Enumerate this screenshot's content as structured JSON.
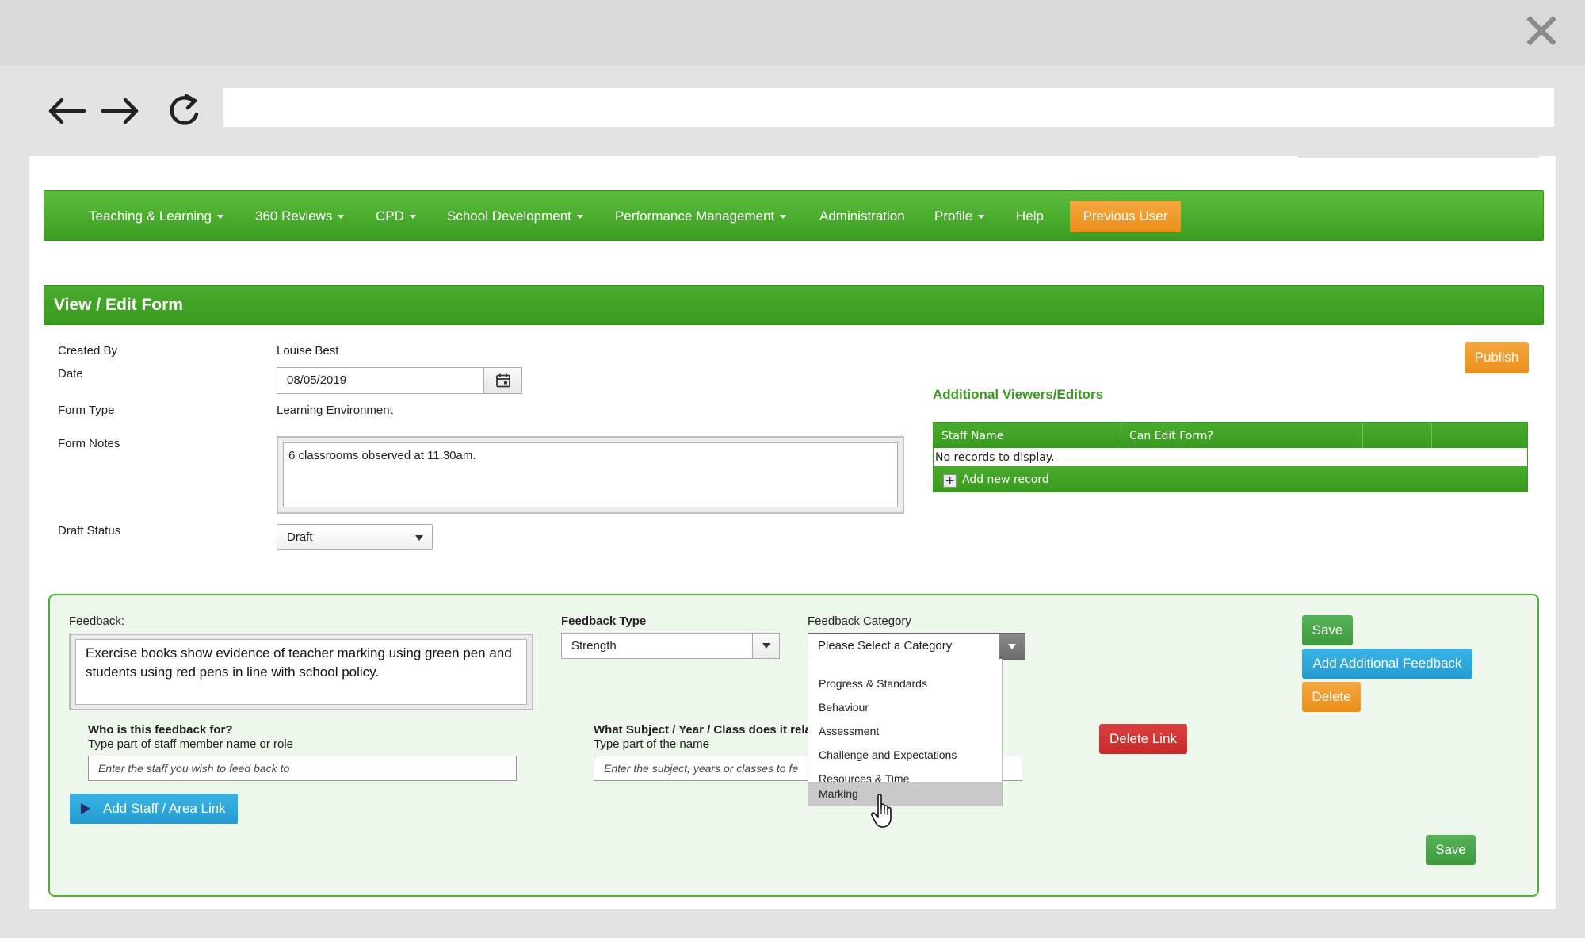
{
  "browser": {
    "address_value": ""
  },
  "nav": {
    "items": [
      {
        "label": "Teaching & Learning",
        "dropdown": true
      },
      {
        "label": "360 Reviews",
        "dropdown": true
      },
      {
        "label": "CPD",
        "dropdown": true
      },
      {
        "label": "School Development",
        "dropdown": true
      },
      {
        "label": "Performance Management",
        "dropdown": true
      },
      {
        "label": "Administration",
        "dropdown": false
      },
      {
        "label": "Profile",
        "dropdown": true
      },
      {
        "label": "Help",
        "dropdown": false
      }
    ],
    "previous_user": "Previous User"
  },
  "form": {
    "title": "View / Edit Form",
    "created_by_label": "Created By",
    "created_by_value": "Louise Best",
    "date_label": "Date",
    "date_value": "08/05/2019",
    "form_type_label": "Form Type",
    "form_type_value": "Learning Environment",
    "notes_label": "Form Notes",
    "notes_value": "6 classrooms observed at 11.30am.",
    "draft_label": "Draft Status",
    "draft_value": "Draft",
    "publish": "Publish"
  },
  "viewers": {
    "title": "Additional Viewers/Editors",
    "columns": [
      "Staff Name",
      "Can Edit Form?",
      "",
      ""
    ],
    "empty": "No records to display.",
    "add": "Add new record"
  },
  "feedback": {
    "label": "Feedback:",
    "text": "Exercise books show evidence of teacher marking using green pen and students using red pens in line with school policy.",
    "type_label": "Feedback Type",
    "type_value": "Strength",
    "category_label": "Feedback Category",
    "category_value": "Please Select a Category",
    "category_options": [
      "Progress & Standards",
      "Behaviour",
      "Assessment",
      "Challenge and Expectations",
      "Resources & Time",
      "Marking"
    ],
    "highlighted_option": "Marking",
    "who_label": "Who is this feedback for?",
    "who_hint": "Type part of staff member name or role",
    "who_placeholder": "Enter the staff you wish to feed back to",
    "subject_label": "What Subject / Year / Class does it rela",
    "subject_hint": "Type part of the name",
    "subject_placeholder": "Enter the subject, years or classes to fe",
    "add_link": "Add Staff / Area Link",
    "save": "Save",
    "add_additional": "Add Additional Feedback",
    "delete": "Delete",
    "delete_link": "Delete Link",
    "save_bottom": "Save"
  },
  "colors": {
    "nav_green": "#4caf2e",
    "orange": "#ef9a2b",
    "blue": "#2ea7da",
    "red": "#d03535",
    "panel_bg": "#eef7ec"
  },
  "icons": [
    "close-icon",
    "back-arrow-icon",
    "forward-arrow-icon",
    "reload-icon",
    "calendar-icon",
    "chevron-down-icon",
    "plus-icon",
    "play-icon",
    "hand-pointer-icon"
  ]
}
